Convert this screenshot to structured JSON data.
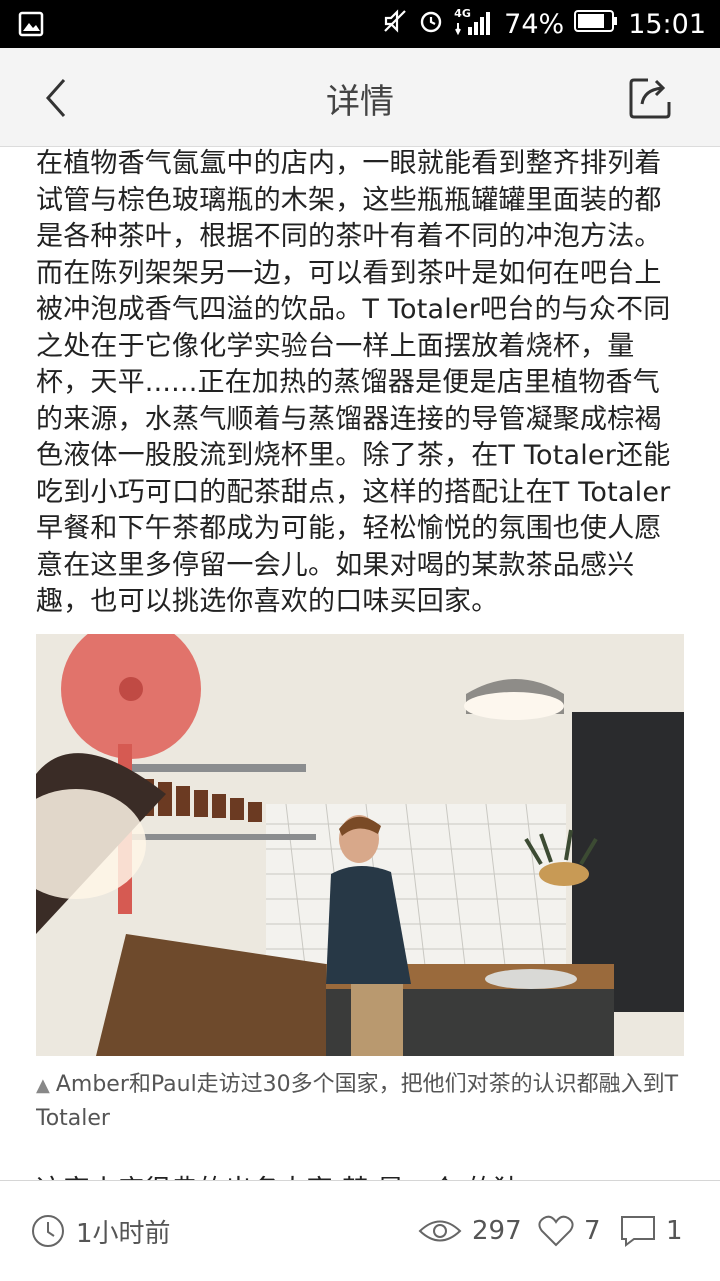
{
  "status_bar": {
    "network": "4G",
    "battery_percent": "74%",
    "time": "15:01",
    "icons": [
      "image-icon",
      "mute-icon",
      "alarm-icon",
      "signal-icon",
      "battery-icon"
    ]
  },
  "header": {
    "title": "详情",
    "back_icon": "back-arrow-icon",
    "share_icon": "share-icon"
  },
  "article": {
    "paragraph": "在植物香气氤氲中的店内，一眼就能看到整齐排列着试管与棕色玻璃瓶的木架，这些瓶瓶罐罐里面装的都是各种茶叶，根据不同的茶叶有着不同的冲泡方法。而在陈列架架另一边，可以看到茶叶是如何在吧台上被冲泡成香气四溢的饮品。T Totaler吧台的与众不同之处在于它像化学实验台一样上面摆放着烧杯，量杯，天平......正在加热的蒸馏器是便是店里植物香气的来源，水蒸气顺着与蒸馏器连接的导管凝聚成棕褐色液体一股股流到烧杯里。除了茶，在T Totaler还能吃到小巧可口的配茶甜点，这样的搭配让在T Totaler早餐和下午茶都成为可能，轻松愉悦的氛围也使人愿意在这里多停留一会儿。如果对喝的某款茶品感兴趣，也可以挑选你喜欢的口味买回家。",
    "caption_marker": "▲",
    "caption": "Amber和Paul走访过30多个国家，把他们对茶的认识都融入到T Totaler",
    "next_paragraph_partial": "这家小店很典的出名大家 楚 是一个 的独"
  },
  "footer": {
    "time_ago": "1小时前",
    "views": "297",
    "likes": "7",
    "comments": "1"
  },
  "colors": {
    "status_bar_bg": "#000000",
    "header_bg": "#f4f4f4",
    "text": "#222222",
    "icon_gray": "#555555"
  }
}
